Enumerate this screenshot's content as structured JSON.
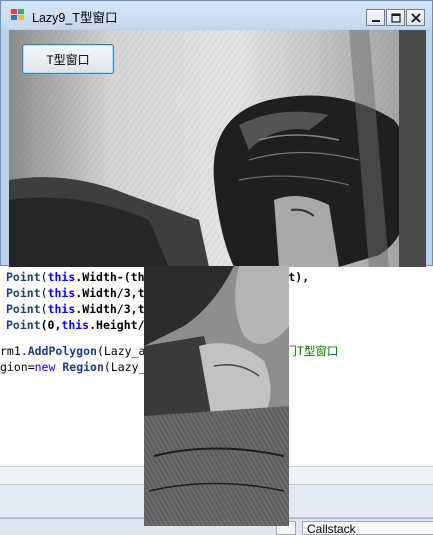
{
  "window": {
    "title": "Lazy9_T型窗口",
    "button_label": "T型窗口"
  },
  "code": {
    "line1": {
      "method": "Point",
      "this1": "this",
      "a": ".Width-(th",
      "b": "ght),"
    },
    "line2": {
      "method": "Point",
      "this1": "this",
      "a": ".Width/3,t"
    },
    "line3": {
      "method": "Point",
      "this1": "this",
      "a": ".Width/3,t"
    },
    "line4": {
      "method": "Point",
      "a": "(0,",
      "this1": "this",
      "b": ".Height/"
    },
    "line5": {
      "a": "rm1.",
      "method": "AddPolygon",
      "b": "(Lazy_a",
      "comment": "门T型窗口"
    },
    "line6": {
      "a": "gion=",
      "kw": "new",
      "cls": "Region",
      "b": "(Lazy_"
    }
  },
  "statusbar": {
    "tab_label": "Callstack"
  },
  "colors": {
    "titlebar": "#c4d8ee",
    "window_frame": "#b9d1ea",
    "keyword": "#0000ff",
    "comment": "#008000"
  }
}
